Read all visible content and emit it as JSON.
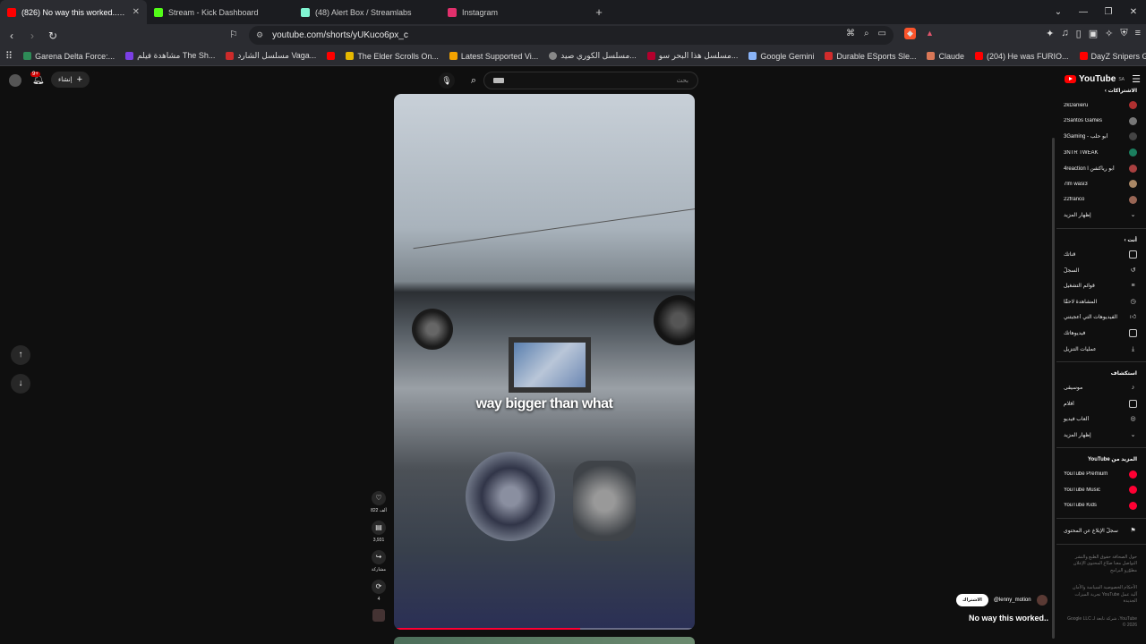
{
  "tabs": [
    {
      "title": "(826) No way this worked.. - YouTube",
      "color": "#ff0000",
      "active": true
    },
    {
      "title": "Stream - Kick Dashboard",
      "color": "#53fc18",
      "active": false
    },
    {
      "title": "(48) Alert Box / Streamlabs",
      "color": "#80f5d2",
      "active": false
    },
    {
      "title": "Instagram",
      "color": "#e1306c",
      "active": false
    }
  ],
  "address": {
    "url": "youtube.com/shorts/yUKuco6px_c"
  },
  "bookmarks": [
    {
      "label": "Garena Delta Force:...",
      "color": "#2e8b57"
    },
    {
      "label": "مشاهدة فيلم The Sh...",
      "color": "#7b3fe4"
    },
    {
      "label": "مسلسل الشارد Vaga...",
      "color": "#cc2b2b"
    },
    {
      "label": "",
      "color": "#ff0000"
    },
    {
      "label": "The Elder Scrolls On...",
      "color": "#e6b800"
    },
    {
      "label": "Latest Supported Vi...",
      "color": "#f4a300"
    },
    {
      "label": "مسلسل الكوري صيد...",
      "color": "#888888"
    },
    {
      "label": "مسلسل هذا البحر سو...",
      "color": "#b3002d"
    },
    {
      "label": "Google Gemini",
      "color": "#8ab4f8"
    },
    {
      "label": "Durable ESports Sle...",
      "color": "#d12c2c"
    },
    {
      "label": "Claude",
      "color": "#d97757"
    },
    {
      "label": "(204) He was FURIO...",
      "color": "#ff0000"
    },
    {
      "label": "DayZ Snipers Get H...",
      "color": "#ff0000"
    }
  ],
  "header": {
    "create_label": "إنشاء",
    "notifications_badge": "9+",
    "search_placeholder": "بحث",
    "logo_text": "YouTube",
    "logo_region": "SA"
  },
  "video": {
    "caption": "way bigger than what",
    "progress": 0.62
  },
  "actions": {
    "likes": "822 ألف",
    "comments": "3,931",
    "share": "مشاركة",
    "remix": "4"
  },
  "channel": {
    "handle": "@lenny_motion",
    "subscribe": "الاشتراك",
    "title": "No way this worked.."
  },
  "sidebar": {
    "subs_header": "الاشتراكات",
    "subscriptions": [
      {
        "name": "2kDanieru",
        "color": "#b03030"
      },
      {
        "name": "2Santos Games",
        "color": "#777777"
      },
      {
        "name": "3Gaming - أبو حلب",
        "color": "#444444"
      },
      {
        "name": "3NTR TWEAK",
        "color": "#1b7f5f"
      },
      {
        "name": "4reaction l أبو ريأكشن",
        "color": "#a94040"
      },
      {
        "name": "7lm wasi3",
        "color": "#aa8866"
      },
      {
        "name": "22franco",
        "color": "#996655"
      }
    ],
    "show_more": "إظهار المزيد",
    "you_header": "أنت",
    "you_items": [
      {
        "label": "قناتك",
        "icon": "channel-icon"
      },
      {
        "label": "السجلّ",
        "icon": "history-icon"
      },
      {
        "label": "قوائم التشغيل",
        "icon": "playlists-icon"
      },
      {
        "label": "المشاهدة لاحقًا",
        "icon": "watch-later-icon"
      },
      {
        "label": "الفيديوهات التي أعجبتني",
        "icon": "liked-icon"
      },
      {
        "label": "فيديوهاتك",
        "icon": "your-videos-icon"
      },
      {
        "label": "عمليات التنزيل",
        "icon": "downloads-icon"
      }
    ],
    "explore_header": "استكشاف",
    "explore_items": [
      {
        "label": "موسيقى",
        "icon": "music-icon"
      },
      {
        "label": "أفلام",
        "icon": "movies-icon"
      },
      {
        "label": "ألعاب فيديو",
        "icon": "gaming-icon"
      },
      {
        "label": "إظهار المزيد",
        "icon": "chevron-down-icon"
      }
    ],
    "more_header": "المزيد من YouTube",
    "more_items": [
      {
        "label": "YouTube Premium",
        "color": "#ff0033"
      },
      {
        "label": "YouTube Music",
        "color": "#ff0033"
      },
      {
        "label": "YouTube Kids",
        "color": "#ff0033"
      }
    ],
    "report": "سجلّ الإبلاغ عن المحتوى",
    "footer1": "حول الصحافة حقوق الطبع والنشر التواصل معنا صنّاع المحتوى الإعلان مطوّرو البرامج",
    "footer2": "الأحكام الخصوصية السياسة والأمان آلية عمل YouTube تجربة الميزات الجديدة",
    "footer3": "YouTube، شركة تابعة لـ Google LLC © 2026"
  }
}
